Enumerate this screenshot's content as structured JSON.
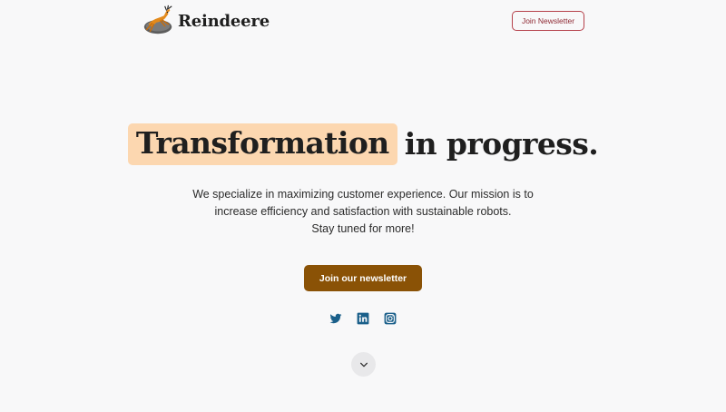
{
  "brand": {
    "name": "Reindeere",
    "logo_icon": "leaping-deer-logo"
  },
  "nav": {
    "newsletter_button": "Join Newsletter"
  },
  "hero": {
    "title_highlight": "Transformation",
    "title_rest": "in progress.",
    "description_line1": "We specialize in maximizing customer experience. Our mission is to",
    "description_line2": "increase efficiency and satisfaction with sustainable robots.",
    "description_line3": "Stay tuned for more!",
    "cta_label": "Join our newsletter"
  },
  "social": [
    {
      "icon": "twitter-icon"
    },
    {
      "icon": "linkedin-icon"
    },
    {
      "icon": "instagram-icon"
    }
  ],
  "scroll_icon": "chevron-down-icon",
  "colors": {
    "background": "#f8f8f9",
    "highlight": "#fcd7b0",
    "cta": "#8a5206",
    "nav_border": "#b5404a",
    "social": "#1a5f8a"
  }
}
